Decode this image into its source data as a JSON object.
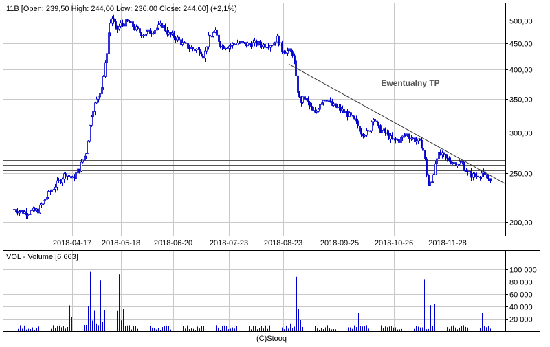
{
  "chart_data": [
    {
      "type": "candlestick",
      "header": "11B [Open: 239,50  High: 244,00  Low: 236,00  Close: 244,00] (+2,1%)",
      "y_scale": "log",
      "ylim": [
        188,
        540
      ],
      "y_ticks": [
        {
          "value": 200,
          "label": "200,00"
        },
        {
          "value": 250,
          "label": "250,00"
        },
        {
          "value": 300,
          "label": "300,00"
        },
        {
          "value": 350,
          "label": "350,00"
        },
        {
          "value": 400,
          "label": "400,00"
        },
        {
          "value": 450,
          "label": "450,00"
        },
        {
          "value": 500,
          "label": "500,00"
        }
      ],
      "x_ticks": [
        "2018-04-17",
        "2018-05-18",
        "2018-06-20",
        "2018-07-23",
        "2018-08-23",
        "2018-09-25",
        "2018-10-26",
        "2018-11-28"
      ],
      "horizontal_lines": [
        409,
        382,
        265,
        259,
        253
      ],
      "annotation": "Ewentualny TP",
      "trendline": {
        "start_value": 410,
        "end_value": 238
      },
      "grid": true,
      "series_approx": [
        {
          "period": "start",
          "close_range": [
            207,
            218
          ]
        },
        {
          "period": "2018-04-17",
          "close": 240
        },
        {
          "period": "2018-05-18",
          "close": 495
        },
        {
          "period": "2018-06-20",
          "close": 440
        },
        {
          "period": "2018-07-23",
          "close": 460
        },
        {
          "period": "2018-08-23",
          "close": 430
        },
        {
          "period": "2018-09-25",
          "close": 320
        },
        {
          "period": "2018-10-26",
          "close": 300
        },
        {
          "period": "2018-11-28",
          "close": 250
        },
        {
          "period": "end",
          "close": 244
        }
      ]
    },
    {
      "type": "bar",
      "header": "VOL - Volume [6 663]",
      "ylim": [
        0,
        130000
      ],
      "y_ticks": [
        {
          "value": 20000,
          "label": "20 000"
        },
        {
          "value": 40000,
          "label": "40 000"
        },
        {
          "value": 60000,
          "label": "60 000"
        },
        {
          "value": 80000,
          "label": "80 000"
        },
        {
          "value": 100000,
          "label": "100 000"
        }
      ],
      "spikes": [
        {
          "near": "2018-05-18",
          "value": 120000
        },
        {
          "near": "2018-08-23",
          "value": 88000
        },
        {
          "near": "2018-11-28",
          "value": 84000
        }
      ]
    }
  ],
  "footer": "(C)Stooq"
}
